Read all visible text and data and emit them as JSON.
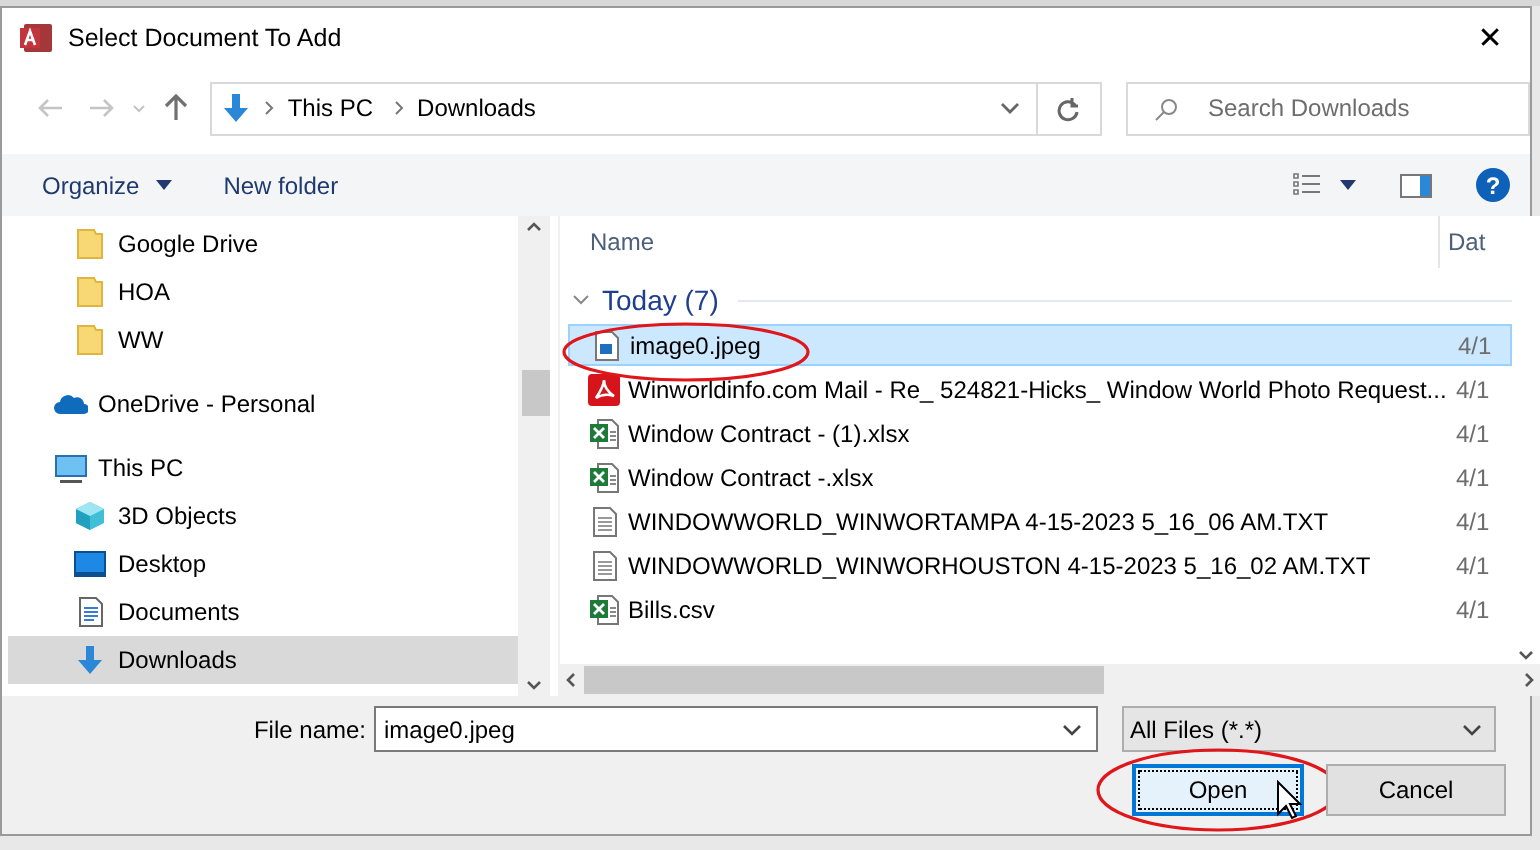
{
  "window": {
    "title": "Select Document To Add",
    "close": "✕"
  },
  "address": {
    "segments": [
      "This PC",
      "Downloads"
    ]
  },
  "search": {
    "placeholder": "Search Downloads"
  },
  "toolbar": {
    "organize": "Organize",
    "new_folder": "New folder",
    "help": "?"
  },
  "sidebar": {
    "continued_items": [
      {
        "label": "Google Drive",
        "kind": "folder",
        "selected": false
      },
      {
        "label": "HOA",
        "kind": "folder",
        "selected": false
      },
      {
        "label": "WW",
        "kind": "folder",
        "selected": false
      }
    ],
    "items": [
      {
        "label": "OneDrive - Personal",
        "kind": "cloud",
        "selected": false
      },
      {
        "label": "This PC",
        "kind": "pc",
        "selected": false,
        "children": [
          {
            "label": "3D Objects",
            "kind": "cube",
            "selected": false
          },
          {
            "label": "Desktop",
            "kind": "desktop",
            "selected": false
          },
          {
            "label": "Documents",
            "kind": "document",
            "selected": false
          },
          {
            "label": "Downloads",
            "kind": "download",
            "selected": true
          }
        ]
      }
    ]
  },
  "files": {
    "columns": [
      "Name",
      "Dat"
    ],
    "group": {
      "label": "Today (7)",
      "expanded": true
    },
    "rows": [
      {
        "name": "image0.jpeg",
        "kind": "image",
        "date": "4/1",
        "selected": true
      },
      {
        "name": "Winworldinfo.com Mail - Re_ 524821-Hicks_ Window World Photo Request...",
        "kind": "pdf",
        "date": "4/1",
        "selected": false
      },
      {
        "name": "Window Contract - (1).xlsx",
        "kind": "excel",
        "date": "4/1",
        "selected": false
      },
      {
        "name": "Window Contract -.xlsx",
        "kind": "excel",
        "date": "4/1",
        "selected": false
      },
      {
        "name": "WINDOWWORLD_WINWORTAMPA 4-15-2023 5_16_06 AM.TXT",
        "kind": "text",
        "date": "4/1",
        "selected": false
      },
      {
        "name": "WINDOWWORLD_WINWORHOUSTON 4-15-2023 5_16_02 AM.TXT",
        "kind": "text",
        "date": "4/1",
        "selected": false
      },
      {
        "name": "Bills.csv",
        "kind": "excel",
        "date": "4/1",
        "selected": false
      }
    ]
  },
  "footer": {
    "file_name_label": "File name:",
    "file_name": "image0.jpeg",
    "filter": "All Files (*.*)",
    "buttons": [
      {
        "label": "Open",
        "kind": "default"
      },
      {
        "label": "Cancel",
        "kind": "normal"
      }
    ]
  }
}
